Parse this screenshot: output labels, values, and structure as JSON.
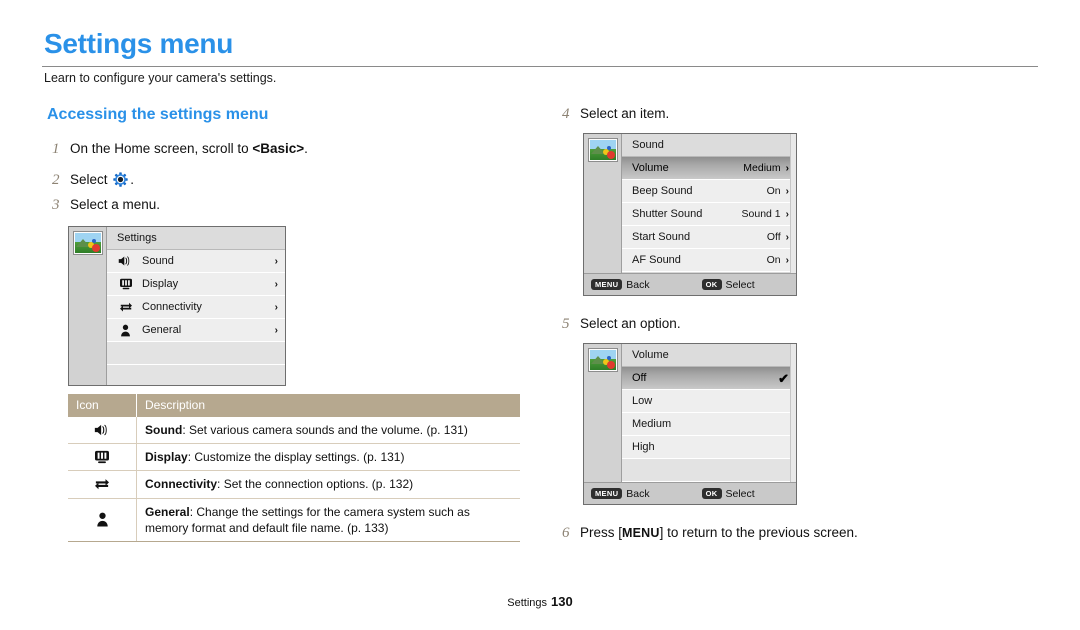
{
  "header": {
    "title": "Settings menu",
    "subtitle": "Learn to configure your camera's settings.",
    "section_title": "Accessing the settings menu",
    "title_color": "#2a91e8"
  },
  "steps": {
    "s1_num": "1",
    "s1_pre": "On the Home screen, scroll to ",
    "s1_bold": "<Basic>",
    "s1_post": ".",
    "s2_num": "2",
    "s2_pre": "Select ",
    "s2_icon": "gear-icon",
    "s2_post": ".",
    "s3_num": "3",
    "s3_text": "Select a menu.",
    "s4_num": "4",
    "s4_text": "Select an item.",
    "s5_num": "5",
    "s5_text": "Select an option.",
    "s6_num": "6",
    "s6_pre": "Press [",
    "s6_key": "MENU",
    "s6_post": "] to return to the previous screen."
  },
  "settings_screen": {
    "thumbnail": "photo-thumbnail-icon",
    "title": "Settings",
    "items": [
      {
        "icon": "speaker-icon",
        "label": "Sound",
        "chevron": "›"
      },
      {
        "icon": "display-icon",
        "label": "Display",
        "chevron": "›"
      },
      {
        "icon": "connectivity-icon",
        "label": "Connectivity",
        "chevron": "›"
      },
      {
        "icon": "person-icon",
        "label": "General",
        "chevron": "›"
      }
    ]
  },
  "sound_screen": {
    "thumbnail": "photo-thumbnail-icon",
    "title": "Sound",
    "rows": [
      {
        "label": "Volume",
        "value": "Medium",
        "chevron": "›",
        "selected": true
      },
      {
        "label": "Beep Sound",
        "value": "On",
        "chevron": "›",
        "selected": false
      },
      {
        "label": "Shutter Sound",
        "value": "Sound 1",
        "chevron": "›",
        "selected": false
      },
      {
        "label": "Start Sound",
        "value": "Off",
        "chevron": "›",
        "selected": false
      },
      {
        "label": "AF Sound",
        "value": "On",
        "chevron": "›",
        "selected": false
      }
    ],
    "footer": {
      "back_key": "MENU",
      "back_label": "Back",
      "select_key": "OK",
      "select_label": "Select"
    }
  },
  "volume_screen": {
    "thumbnail": "photo-thumbnail-icon",
    "title": "Volume",
    "rows": [
      {
        "label": "Off",
        "check": "✔",
        "selected": true
      },
      {
        "label": "Low",
        "check": "",
        "selected": false
      },
      {
        "label": "Medium",
        "check": "",
        "selected": false
      },
      {
        "label": "High",
        "check": "",
        "selected": false
      }
    ],
    "footer": {
      "back_key": "MENU",
      "back_label": "Back",
      "select_key": "OK",
      "select_label": "Select"
    }
  },
  "table": {
    "header_bg": "#b6a88f",
    "col_icon": "Icon",
    "col_description": "Description",
    "rows": [
      {
        "icon": "speaker-icon",
        "name": "Sound",
        "sep": ": ",
        "desc": "Set various camera sounds and the volume. (p. 131)"
      },
      {
        "icon": "display-icon",
        "name": "Display",
        "sep": ": ",
        "desc": "Customize the display settings. (p. 131)"
      },
      {
        "icon": "connectivity-icon",
        "name": "Connectivity",
        "sep": ": ",
        "desc": "Set the connection options. (p. 132)"
      },
      {
        "icon": "person-icon",
        "name": "General",
        "sep": ": ",
        "desc": "Change the settings for the camera system such as memory format and default file name. (p. 133)"
      }
    ]
  },
  "footer": {
    "label": "Settings",
    "page": "130"
  }
}
